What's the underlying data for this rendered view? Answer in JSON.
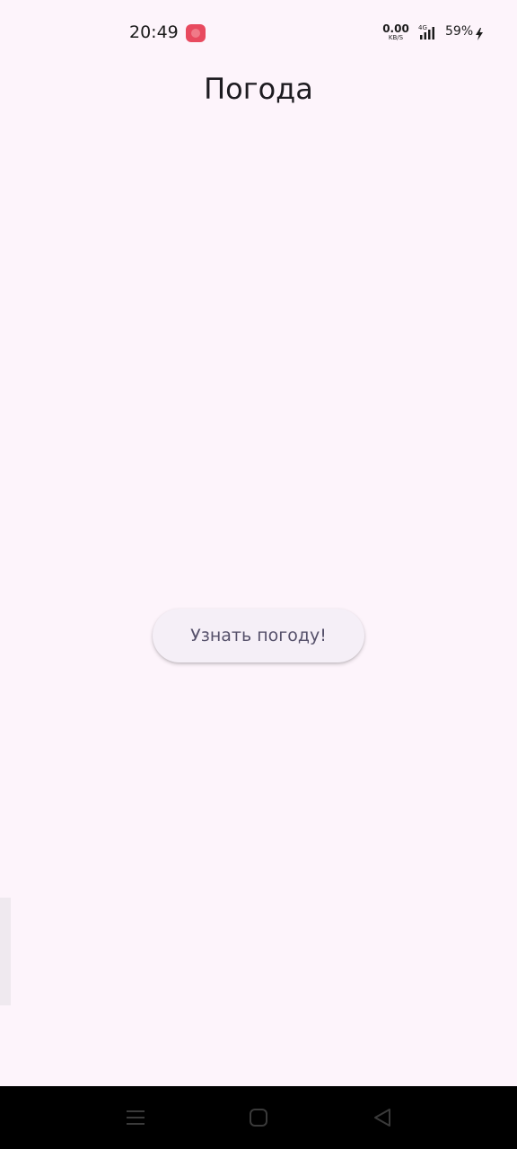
{
  "status_bar": {
    "time": "20:49",
    "network_speed_value": "0.00",
    "network_speed_unit": "KB/S",
    "battery": "59%",
    "icons": [
      "app-notification-icon",
      "signal-4g-icon",
      "charging-bolt-icon"
    ]
  },
  "header": {
    "title": "Погода"
  },
  "main": {
    "button_label": "Узнать погоду!"
  },
  "nav_bar": {
    "icons": [
      "menu-icon",
      "home-icon",
      "back-icon"
    ]
  },
  "colors": {
    "background": "#FDF4FB",
    "button_background": "#F5EFF7",
    "button_text": "#55506A",
    "nav_bar": "#000000"
  }
}
